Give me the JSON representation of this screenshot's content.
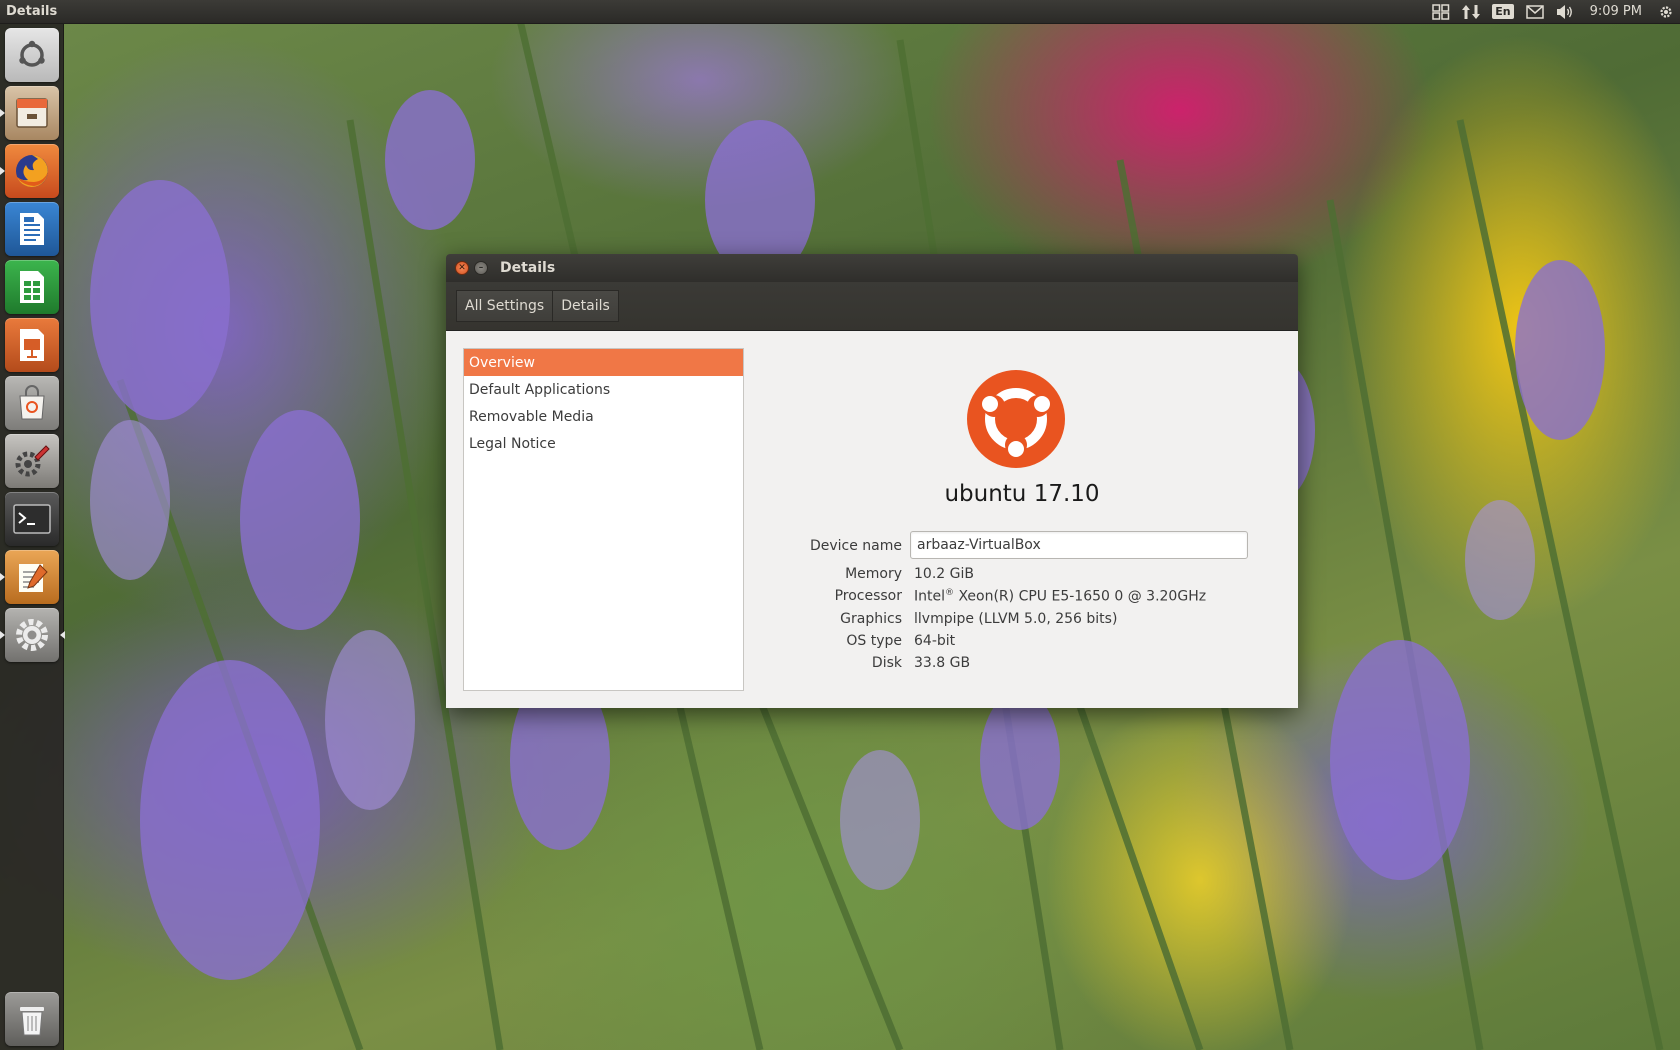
{
  "top_panel": {
    "app_title": "Details",
    "language": "En",
    "clock": "9:09 PM"
  },
  "launcher": {
    "items": [
      {
        "name": "ubuntu-dash",
        "icon": "ubuntu-logo-icon",
        "color": "#d9d9d9"
      },
      {
        "name": "files",
        "icon": "file-cabinet-icon",
        "color": "#c9a27a"
      },
      {
        "name": "firefox",
        "icon": "firefox-icon",
        "color": "#e8632a"
      },
      {
        "name": "libreoffice-writer",
        "icon": "writer-document-icon",
        "color": "#2c6db8"
      },
      {
        "name": "libreoffice-calc",
        "icon": "calc-spreadsheet-icon",
        "color": "#2e9b3e"
      },
      {
        "name": "libreoffice-impress",
        "icon": "impress-presentation-icon",
        "color": "#d65d27"
      },
      {
        "name": "ubuntu-software",
        "icon": "shopping-bag-icon",
        "color": "#8d8c8a"
      },
      {
        "name": "system-tools",
        "icon": "wrench-gear-icon",
        "color": "#9a9894"
      },
      {
        "name": "terminal",
        "icon": "terminal-icon",
        "color": "#4a4a4a"
      },
      {
        "name": "text-editor",
        "icon": "text-editor-icon",
        "color": "#d98a3a"
      },
      {
        "name": "system-settings",
        "icon": "gear-icon",
        "color": "#8f8e8c"
      },
      {
        "name": "trash",
        "icon": "trash-icon",
        "color": "#7a7976"
      }
    ]
  },
  "window": {
    "title": "Details",
    "breadcrumbs": [
      "All Settings",
      "Details"
    ],
    "sidebar": {
      "items": [
        "Overview",
        "Default Applications",
        "Removable Media",
        "Legal Notice"
      ],
      "selected": "Overview"
    },
    "overview": {
      "os_name": "ubuntu 17.10",
      "device_name_label": "Device name",
      "device_name_value": "arbaaz-VirtualBox",
      "memory_label": "Memory",
      "memory_value": "10.2 GiB",
      "processor_label": "Processor",
      "processor_value_prefix": "Intel",
      "processor_value_reg": "®",
      "processor_value_suffix": " Xeon(R) CPU E5-1650 0 @ 3.20GHz",
      "graphics_label": "Graphics",
      "graphics_value": "llvmpipe (LLVM 5.0, 256 bits)",
      "os_type_label": "OS type",
      "os_type_value": "64-bit",
      "disk_label": "Disk",
      "disk_value": "33.8 GB"
    }
  },
  "colors": {
    "accent": "#f07746",
    "ubuntu_orange": "#e95420",
    "panel": "#2b2a27"
  }
}
